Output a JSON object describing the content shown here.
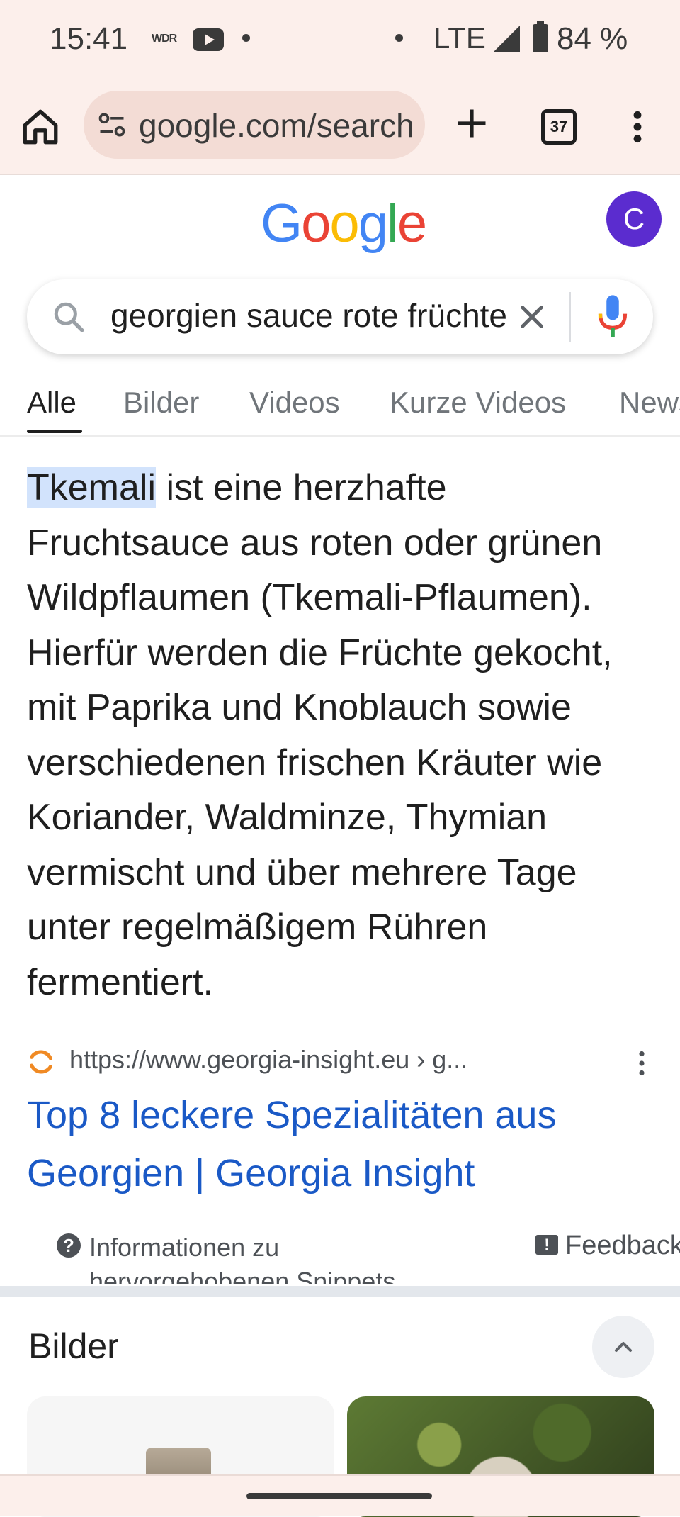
{
  "status_bar": {
    "time": "15:41",
    "wdr": "WDR",
    "network": "LTE",
    "battery": "84 %"
  },
  "browser": {
    "url": "google.com/search",
    "tab_count": "37"
  },
  "google": {
    "avatar_letter": "C",
    "query": "georgien sauce rote früchte"
  },
  "tabs": [
    "Alle",
    "Bilder",
    "Videos",
    "Kurze Videos",
    "News"
  ],
  "snippet": {
    "highlight": "Tkemali",
    "text": " ist eine herzhafte Fruchtsauce aus roten oder grünen Wildpflaumen (Tkemali-Pflaumen). Hierfür werden die Früchte gekocht, mit Paprika und Knoblauch sowie verschiedenen frischen Kräuter wie Koriander, Waldminze, Thymian vermischt und über mehrere Tage unter regelmäßigem Rühren fermentiert."
  },
  "result": {
    "url": "https://www.georgia-insight.eu › g...",
    "title": "Top 8 leckere Spezialitäten aus Georgien | Georgia Insight"
  },
  "footer": {
    "info": "Informationen zu hervorgehobenen Snippets",
    "feedback": "Feedback"
  },
  "images_section": {
    "title": "Bilder"
  },
  "colors": {
    "link": "#1a59c6",
    "highlight": "#d2e3fc",
    "chrome_bg": "#fcefeb",
    "avatar": "#5b2ccf"
  }
}
